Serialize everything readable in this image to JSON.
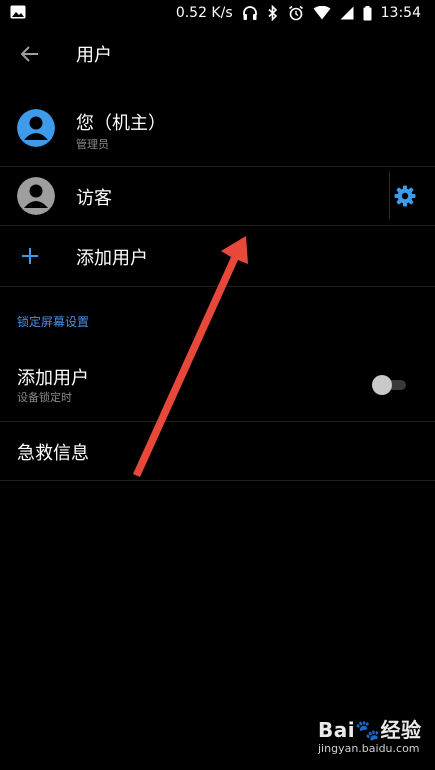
{
  "status_bar": {
    "speed": "0.52 K/s",
    "time": "13:54"
  },
  "header": {
    "title": "用户"
  },
  "users": [
    {
      "name": "您（机主）",
      "role": "管理员",
      "avatar_color": "#3d9be9"
    },
    {
      "name": "访客",
      "avatar_color": "#9e9e9e"
    }
  ],
  "add_user": {
    "label": "添加用户"
  },
  "lock_screen": {
    "section_label": "锁定屏幕设置",
    "add_users_pref": {
      "title": "添加用户",
      "subtitle": "设备锁定时",
      "enabled": false
    },
    "emergency_info": {
      "title": "急救信息"
    }
  },
  "watermark": {
    "logo": "Bai🐾经验",
    "url": "jingyan.baidu.com"
  },
  "colors": {
    "accent": "#3d9be9",
    "annotation_arrow": "#e8483a"
  }
}
